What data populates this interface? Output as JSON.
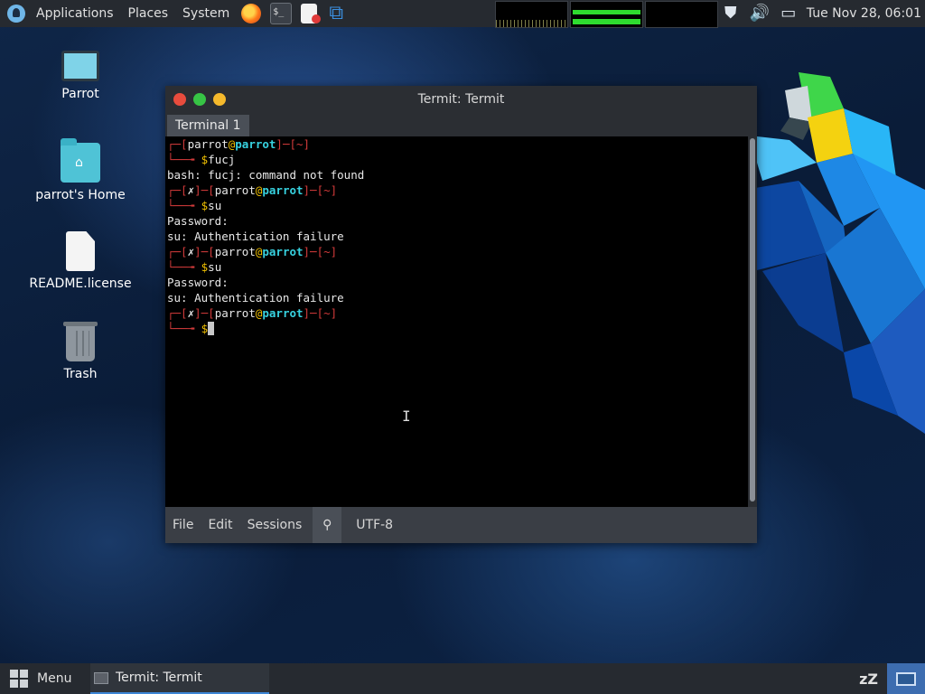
{
  "top_panel": {
    "menu": [
      "Applications",
      "Places",
      "System"
    ],
    "launchers": [
      "firefox-icon",
      "terminal-icon",
      "text-editor-icon",
      "vscode-icon"
    ],
    "clock": "Tue Nov 28, 06:01"
  },
  "desktop_icons": [
    {
      "label": "Parrot",
      "icon": "computer-icon"
    },
    {
      "label": "parrot's Home",
      "icon": "home-folder-icon"
    },
    {
      "label": "README.license",
      "icon": "file-icon"
    },
    {
      "label": "Trash",
      "icon": "trash-icon"
    }
  ],
  "window": {
    "title": "Termit: Termit",
    "tab": "Terminal 1",
    "menu": [
      "File",
      "Edit",
      "Sessions"
    ],
    "encoding": "UTF-8"
  },
  "terminal": {
    "user": "parrot",
    "host": "parrot",
    "dir": "~",
    "cmd1": "fucj",
    "out1": "bash: fucj: command not found",
    "cmd2": "su",
    "out2a": "Password:",
    "out2b": "su: Authentication failure",
    "cmd3": "su",
    "out3a": "Password:",
    "out3b": "su: Authentication failure",
    "fail_mark": "✗"
  },
  "bottom_panel": {
    "menu_label": "Menu",
    "task_label": "Termit: Termit"
  },
  "colors": {
    "prompt_frame": "#d23a3a",
    "host": "#37d2e0",
    "dollar": "#f0c000",
    "accent": "#3d86d6"
  }
}
